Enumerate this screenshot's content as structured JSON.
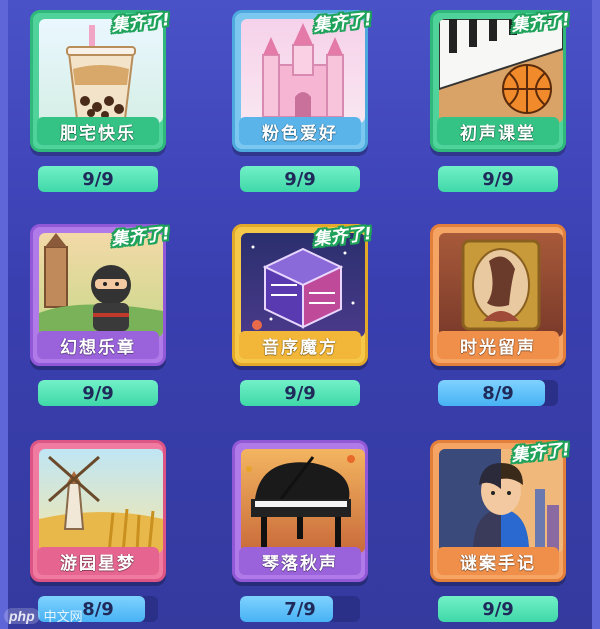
{
  "collection": {
    "badge_text": "集齐了!",
    "cards": [
      {
        "name": "肥宅快乐",
        "progress": "9/9",
        "collected": 9,
        "total": 9,
        "complete": true,
        "theme": "green",
        "icon": "bubble-tea-icon"
      },
      {
        "name": "粉色爱好",
        "progress": "9/9",
        "collected": 9,
        "total": 9,
        "complete": true,
        "theme": "blue",
        "icon": "pink-castle-icon"
      },
      {
        "name": "初声课堂",
        "progress": "9/9",
        "collected": 9,
        "total": 9,
        "complete": true,
        "theme": "green",
        "icon": "piano-basketball-icon"
      },
      {
        "name": "幻想乐章",
        "progress": "9/9",
        "collected": 9,
        "total": 9,
        "complete": true,
        "theme": "purple",
        "icon": "ninja-castle-icon"
      },
      {
        "name": "音序魔方",
        "progress": "9/9",
        "collected": 9,
        "total": 9,
        "complete": true,
        "theme": "yellow",
        "icon": "magic-cube-icon"
      },
      {
        "name": "时光留声",
        "progress": "8/9",
        "collected": 8,
        "total": 9,
        "complete": false,
        "theme": "orange",
        "icon": "portrait-frame-icon"
      },
      {
        "name": "游园星梦",
        "progress": "8/9",
        "collected": 8,
        "total": 9,
        "complete": false,
        "theme": "pink",
        "icon": "windmill-icon"
      },
      {
        "name": "琴落秋声",
        "progress": "7/9",
        "collected": 7,
        "total": 9,
        "complete": false,
        "theme": "purple",
        "icon": "grand-piano-icon"
      },
      {
        "name": "谜案手记",
        "progress": "9/9",
        "collected": 9,
        "total": 9,
        "complete": true,
        "theme": "orange",
        "icon": "detective-icon"
      }
    ]
  },
  "watermark": {
    "logo": "php",
    "text": "中文网"
  }
}
